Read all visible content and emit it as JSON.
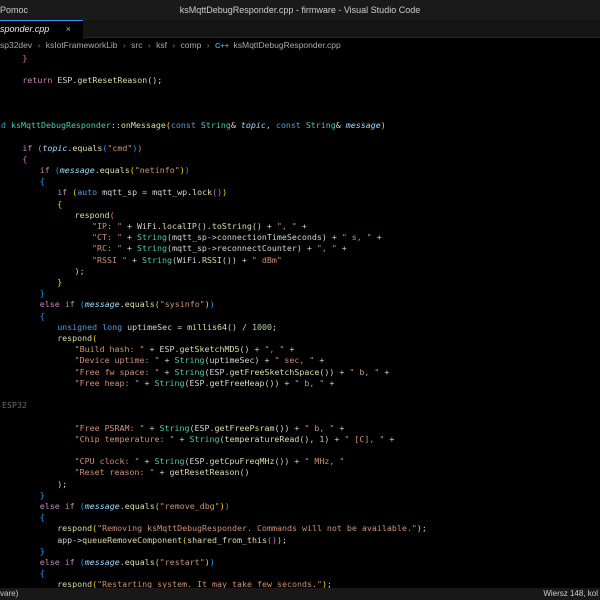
{
  "window": {
    "menu_fragment": "Pomoc",
    "title": "ksMqttDebugResponder.cpp - firmware - Visual Studio Code"
  },
  "tabs": [
    {
      "label": "sponder.cpp",
      "close_glyph": "×"
    }
  ],
  "breadcrumb": {
    "segments": [
      "sp32dev",
      "ksIotFrameworkLib",
      "src",
      "ksf",
      "comp"
    ],
    "file_icon_label": "C++",
    "file": "ksMqttDebugResponder.cpp",
    "separator": "›"
  },
  "status": {
    "left": "vare)",
    "right": "Wiersz 148, kol"
  },
  "editor": {
    "lines": [
      [
        [
          "}",
          "brM"
        ]
      ],
      [],
      [
        [
          "return",
          "ctl"
        ],
        [
          " ESP.",
          ""
        ],
        [
          "getResetReason",
          "fn"
        ],
        [
          "();",
          ""
        ]
      ],
      [],
      [],
      [],
      [
        [
          "id ",
          "kw"
        ],
        [
          "ksMqttDebugResponder",
          "ty"
        ],
        [
          "::",
          ""
        ],
        [
          "onMessage",
          "fn"
        ],
        [
          "(",
          "brY"
        ],
        [
          "const",
          "kw"
        ],
        [
          " ",
          ""
        ],
        [
          "String",
          "ty"
        ],
        [
          "& ",
          ""
        ],
        [
          "topic",
          "prm"
        ],
        [
          ", ",
          ""
        ],
        [
          "const",
          "kw"
        ],
        [
          " ",
          ""
        ],
        [
          "String",
          "ty"
        ],
        [
          "& ",
          ""
        ],
        [
          "message",
          "prm"
        ],
        [
          ")",
          "brY"
        ]
      ],
      [],
      [
        [
          "if",
          "ctl"
        ],
        [
          " ",
          ""
        ],
        [
          "(",
          "brM"
        ],
        [
          "topic",
          "prm"
        ],
        [
          ".",
          ""
        ],
        [
          "equals",
          "fn"
        ],
        [
          "(",
          "brB"
        ],
        [
          "\"cmd\"",
          "str"
        ],
        [
          ")",
          "brB"
        ],
        [
          ")",
          "brM"
        ]
      ],
      [
        [
          "{",
          "brM"
        ]
      ],
      [
        [
          "if",
          "ctl"
        ],
        [
          " ",
          ""
        ],
        [
          "(",
          "brB"
        ],
        [
          "message",
          "prm"
        ],
        [
          ".",
          ""
        ],
        [
          "equals",
          "fn"
        ],
        [
          "(",
          "brY"
        ],
        [
          "\"netinfo\"",
          "str"
        ],
        [
          ")",
          "brY"
        ],
        [
          ")",
          "brB"
        ]
      ],
      [
        [
          "{",
          "brB"
        ]
      ],
      [
        [
          "if",
          "ctl"
        ],
        [
          " ",
          ""
        ],
        [
          "(",
          "brY"
        ],
        [
          "auto",
          "kw"
        ],
        [
          " mqtt_sp = mqtt_wp.",
          ""
        ],
        [
          "lock",
          "fn"
        ],
        [
          "()",
          "brM"
        ],
        [
          ")",
          "brY"
        ]
      ],
      [
        [
          "{",
          "brY"
        ]
      ],
      [
        [
          "respond",
          "fn"
        ],
        [
          "(",
          "brM"
        ]
      ],
      [
        [
          "\"IP: \"",
          "str"
        ],
        [
          " + WiFi.",
          ""
        ],
        [
          "localIP",
          "fn"
        ],
        [
          "().",
          ""
        ],
        [
          "toString",
          "fn"
        ],
        [
          "() + ",
          ""
        ],
        [
          "\", \"",
          "str"
        ],
        [
          " +",
          ""
        ]
      ],
      [
        [
          "\"CT: \"",
          "str"
        ],
        [
          " + ",
          ""
        ],
        [
          "String",
          "ty"
        ],
        [
          "(mqtt_sp->connectionTimeSeconds) + ",
          ""
        ],
        [
          "\" s, \"",
          "str"
        ],
        [
          " +",
          ""
        ]
      ],
      [
        [
          "\"RC: \"",
          "str"
        ],
        [
          " + ",
          ""
        ],
        [
          "String",
          "ty"
        ],
        [
          "(mqtt_sp->reconnectCounter) + ",
          ""
        ],
        [
          "\", \"",
          "str"
        ],
        [
          " +",
          ""
        ]
      ],
      [
        [
          "\"RSSI \"",
          "str"
        ],
        [
          " + ",
          ""
        ],
        [
          "String",
          "ty"
        ],
        [
          "(WiFi.",
          ""
        ],
        [
          "RSSI",
          "fn"
        ],
        [
          "()) + ",
          ""
        ],
        [
          "\" dBm\"",
          "str"
        ]
      ],
      [
        [
          ");",
          ""
        ]
      ],
      [
        [
          "}",
          "brY"
        ]
      ],
      [
        [
          "}",
          "brB"
        ]
      ],
      [
        [
          "else",
          "ctl"
        ],
        [
          " ",
          ""
        ],
        [
          "if",
          "ctl"
        ],
        [
          " ",
          ""
        ],
        [
          "(",
          "brB"
        ],
        [
          "message",
          "prm"
        ],
        [
          ".",
          ""
        ],
        [
          "equals",
          "fn"
        ],
        [
          "(",
          "brY"
        ],
        [
          "\"sysinfo\"",
          "str"
        ],
        [
          ")",
          "brY"
        ],
        [
          ")",
          "brB"
        ]
      ],
      [
        [
          "{",
          "brB"
        ]
      ],
      [
        [
          "unsigned",
          "kw"
        ],
        [
          " ",
          ""
        ],
        [
          "long",
          "kw"
        ],
        [
          " uptimeSec = ",
          ""
        ],
        [
          "millis64",
          "fn"
        ],
        [
          "() / ",
          ""
        ],
        [
          "1000",
          "num"
        ],
        [
          ";",
          ""
        ]
      ],
      [
        [
          "respond",
          "fn"
        ],
        [
          "(",
          "brY"
        ]
      ],
      [
        [
          "\"Build hash: \"",
          "str"
        ],
        [
          " + ESP.",
          ""
        ],
        [
          "getSketchMD5",
          "fn"
        ],
        [
          "() + ",
          ""
        ],
        [
          "\", \"",
          "str"
        ],
        [
          " +",
          ""
        ]
      ],
      [
        [
          "\"Device uptime: \"",
          "str"
        ],
        [
          " + ",
          ""
        ],
        [
          "String",
          "ty"
        ],
        [
          "(uptimeSec) + ",
          ""
        ],
        [
          "\" sec, \"",
          "str"
        ],
        [
          " +",
          ""
        ]
      ],
      [
        [
          "\"Free fw space: \"",
          "str"
        ],
        [
          " + ",
          ""
        ],
        [
          "String",
          "ty"
        ],
        [
          "(ESP.",
          ""
        ],
        [
          "getFreeSketchSpace",
          "fn"
        ],
        [
          "()) + ",
          ""
        ],
        [
          "\" b, \"",
          "str"
        ],
        [
          " +",
          ""
        ]
      ],
      [
        [
          "\"Free heap: \"",
          "str"
        ],
        [
          " + ",
          ""
        ],
        [
          "String",
          "ty"
        ],
        [
          "(ESP.",
          ""
        ],
        [
          "getFreeHeap",
          "fn"
        ],
        [
          "()) + ",
          ""
        ],
        [
          "\" b, \"",
          "str"
        ],
        [
          " +",
          ""
        ]
      ],
      [],
      [
        [
          "ESP32",
          "dim"
        ]
      ],
      [],
      [
        [
          "\"Free PSRAM: \"",
          "str"
        ],
        [
          " + ",
          ""
        ],
        [
          "String",
          "ty"
        ],
        [
          "(ESP.",
          ""
        ],
        [
          "getFreePsram",
          "fn"
        ],
        [
          "()) + ",
          ""
        ],
        [
          "\" b, \"",
          "str"
        ],
        [
          " +",
          ""
        ]
      ],
      [
        [
          "\"Chip temperature: \"",
          "str"
        ],
        [
          " + ",
          ""
        ],
        [
          "String",
          "ty"
        ],
        [
          "(",
          ""
        ],
        [
          "temperatureRead",
          "fn"
        ],
        [
          "(), ",
          ""
        ],
        [
          "1",
          "num"
        ],
        [
          ") + ",
          ""
        ],
        [
          "\" [C], \"",
          "str"
        ],
        [
          " +",
          ""
        ]
      ],
      [],
      [
        [
          "\"CPU clock: \"",
          "str"
        ],
        [
          " + ",
          ""
        ],
        [
          "String",
          "ty"
        ],
        [
          "(ESP.",
          ""
        ],
        [
          "getCpuFreqMHz",
          "fn"
        ],
        [
          "()) + ",
          ""
        ],
        [
          "\" MHz, \"",
          "str"
        ]
      ],
      [
        [
          "\"Reset reason: \"",
          "str"
        ],
        [
          " + ",
          ""
        ],
        [
          "getResetReason",
          "fn"
        ],
        [
          "()",
          ""
        ]
      ],
      [
        [
          ");",
          ""
        ]
      ],
      [
        [
          "}",
          "brB"
        ]
      ],
      [
        [
          "else",
          "ctl"
        ],
        [
          " ",
          ""
        ],
        [
          "if",
          "ctl"
        ],
        [
          " ",
          ""
        ],
        [
          "(",
          "brB"
        ],
        [
          "message",
          "prm"
        ],
        [
          ".",
          ""
        ],
        [
          "equals",
          "fn"
        ],
        [
          "(",
          "brY"
        ],
        [
          "\"remove_dbg\"",
          "str"
        ],
        [
          ")",
          "brY"
        ],
        [
          ")",
          "brB"
        ]
      ],
      [
        [
          "{",
          "brB"
        ]
      ],
      [
        [
          "respond",
          "fn"
        ],
        [
          "(",
          "brY"
        ],
        [
          "\"Removing ksMqttDebugResponder. Commands will not be available.\"",
          "str"
        ],
        [
          ")",
          "brY"
        ],
        [
          ";",
          ""
        ]
      ],
      [
        [
          "app->",
          ""
        ],
        [
          "queueRemoveComponent",
          "fn"
        ],
        [
          "(",
          "brY"
        ],
        [
          "shared_from_this",
          "fn"
        ],
        [
          "()",
          "brM"
        ],
        [
          ")",
          "brY"
        ],
        [
          ";",
          ""
        ]
      ],
      [
        [
          "}",
          "brB"
        ]
      ],
      [
        [
          "else",
          "ctl"
        ],
        [
          " ",
          ""
        ],
        [
          "if",
          "ctl"
        ],
        [
          " ",
          ""
        ],
        [
          "(",
          "brB"
        ],
        [
          "message",
          "prm"
        ],
        [
          ".",
          ""
        ],
        [
          "equals",
          "fn"
        ],
        [
          "(",
          "brY"
        ],
        [
          "\"restart\"",
          "str"
        ],
        [
          ")",
          "brY"
        ],
        [
          ")",
          "brB"
        ]
      ],
      [
        [
          "{",
          "brB"
        ]
      ],
      [
        [
          "respond",
          "fn"
        ],
        [
          "(",
          "brY"
        ],
        [
          "\"Restarting system. It may take few seconds.\"",
          "str"
        ],
        [
          ")",
          "brY"
        ],
        [
          ";",
          ""
        ]
      ],
      [
        [
          "delay",
          "fn"
        ],
        [
          "(",
          "brY"
        ],
        [
          "500",
          "num"
        ],
        [
          ")",
          "brY"
        ],
        [
          ";",
          ""
        ]
      ],
      [
        [
          "ESP.",
          ""
        ],
        [
          "restart",
          "fn"
        ],
        [
          "();",
          ""
        ]
      ],
      [
        [
          "}",
          "brB"
        ]
      ]
    ]
  }
}
